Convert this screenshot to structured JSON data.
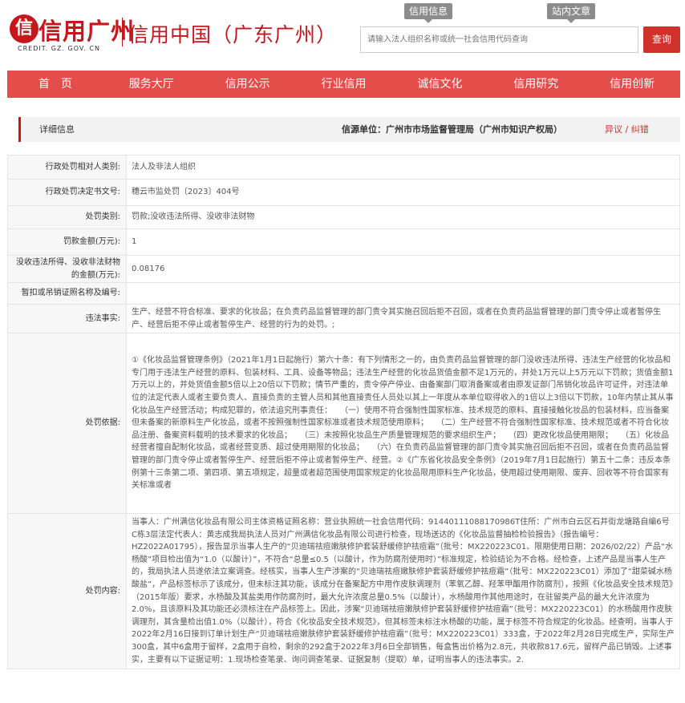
{
  "header": {
    "logo_mark": "信",
    "logo_text": "信用广州",
    "logo_url": "CREDIT. GZ. GOV. CN",
    "site_name": "信用中国（广东广州）",
    "top_tabs": [
      "信用信息",
      "站内文章"
    ],
    "search_placeholder": "请输入法人组织名称或统一社会信用代码查询",
    "search_button": "查询"
  },
  "nav": {
    "items": [
      "首　页",
      "服务大厅",
      "信用公示",
      "行业信用",
      "诚信文化",
      "信用研究",
      "信用创新"
    ]
  },
  "detail": {
    "title": "详细信息",
    "unit_label": "信源单位：广州市市场监督管理局（广州市知识产权局）",
    "objection": "异议 / 纠错"
  },
  "colors": {
    "brand_red": "#c8161d",
    "nav_red": "#e44d4a"
  },
  "table": {
    "rows": [
      {
        "label": "行政处罚相对人类别:",
        "value": "法人及非法人组织"
      },
      {
        "label": "行政处罚决定书文号:",
        "value": "穗云市监处罚〔2023〕404号"
      },
      {
        "label": "处罚类别:",
        "value": "罚款;没收违法所得、没收非法财物"
      },
      {
        "label": "罚款金额(万元):",
        "value": "1"
      },
      {
        "label": "没收违法所得、没收非法财物的金额(万元):",
        "value": "0.08176"
      },
      {
        "label": "暂扣或吊销证照名称及编号:",
        "value": ""
      },
      {
        "label": "违法事实:",
        "value": "生产、经营不符合标准、要求的化妆品；在负责药品监督管理的部门责令其实施召回后拒不召回，或者在负责药品监督管理的部门责令停止或者暂停生产、经营后拒不停止或者暂停生产、经营的行为的处罚。;"
      },
      {
        "label": "处罚依据:",
        "value": "①《化妆品监督管理条例》（2021年1月1日起施行）第六十条：有下列情形之一的，由负责药品监督管理的部门没收违法所得、违法生产经营的化妆品和专门用于违法生产经营的原料、包装材料、工具、设备等物品；违法生产经营的化妆品货值金额不足1万元的，并处1万元以上5万元以下罚款；货值金额1万元以上的，并处货值金额5倍以上20倍以下罚款；情节严重的，责令停产停业、由备案部门取消备案或者由原发证部门吊销化妆品许可证件，对违法单位的法定代表人或者主要负责人、直接负责的主管人员和其他直接责任人员处以其上一年度从本单位取得收入的1倍以上3倍以下罚款，10年内禁止其从事化妆品生产经营活动；构成犯罪的，依法追究刑事责任：　　（一）使用不符合强制性国家标准、技术规范的原料、直接接触化妆品的包装材料，应当备案但未备案的新原料生产化妆品，或者不按照强制性国家标准或者技术规范使用原料；　　（二）生产经营不符合强制性国家标准、技术规范或者不符合化妆品注册、备案资料载明的技术要求的化妆品；　　（三）未按照化妆品生产质量管理规范的要求组织生产；　　（四）更改化妆品使用期限；　　（五）化妆品经营者擅自配制化妆品，或者经营变质、超过使用期限的化妆品；　　（六）在负责药品监督管理的部门责令其实施召回后拒不召回，或者在负责药品监督管理的部门责令停止或者暂停生产、经营后拒不停止或者暂停生产、经营。②《广东省化妆品安全条例》（2019年7月1日起施行）第五十二条：违反本条例第十三条第二项、第四项、第五项规定，超量或者超范围使用国家规定的化妆品限用原料生产化妆品，使用超过使用期限、废弃、回收等不符合国家有关标准或者"
      },
      {
        "label": "处罚内容:",
        "value": "当事人：广州满信化妆品有限公司主体资格证照名称：营业执照统一社会信用代码：91440111088170986T住所：广州市白云区石井街龙塘路自编6号C栋3层法定代表人：黄志成我局执法人员对广州满信化妆品有限公司进行检查，现场送达的《化妆品监督抽检检验报告》（报告编号：HZ2022A01795），报告显示当事人生产的“贝迪瑞祛痘嫩肤修护套装舒缓修护祛痘霜”（批号：MX220223C01、限期使用日期：2026/02/22）产品“水杨酸”项目检出值为“1.0（以酸计）”，不符合“总量≤0.5（以酸计，作为防腐剂使用时）”标准规定，检验结论为不合格。经检查，上述产品是当事人生产的，我局执法人员遂依法立案调查。经核实，当事人生产涉案的“贝迪瑞祛痘嫩肤修护套装舒缓修护祛痘霜”（批号：MX220223C01）添加了“甜菜碱水杨酸盐”，产品标签标示了该成分，但未标注其功能，该成分在备案配方中用作皮肤调理剂（苯氧乙醇、羟苯甲酯用作防腐剂），按照《化妆品安全技术规范》（2015年版）要求，水杨酸及其盐类用作防腐剂时，最大允许浓度总量0.5%（以酸计），水杨酸用作其他用途时，在驻留类产品的最大允许浓度为2.0%，且该原料及其功能还必须标注在产品标签上。因此，涉案“贝迪瑞祛痘嫩肤修护套装舒缓修护祛痘霜”（批号：MX220223C01）的水杨酸用作皮肤调理剂，其含量检出值1.0%（以酸计），符合《化妆品安全技术规范》，但其标签未标注水杨酸的功能，属于标签不符合规定的化妆品。经查明，当事人于2022年2月16日接到订单计划生产“贝迪瑞祛痘嫩肤修护套装舒缓修护祛痘霜”（批号：MX220223C01）333盒，于2022年2月28日完成生产，实际生产300盒，其中6盒用于留样，2盒用于自检，剩余的292盒于2022年3月6日全部销售，每盒售出价格为2.8元，共收款817.6元，留样产品已销毁。上述事实，主要有以下证据证明：1.现场检查笔录、询问调查笔录、证据复制（提取）单，证明当事人的违法事实。2."
      }
    ]
  }
}
